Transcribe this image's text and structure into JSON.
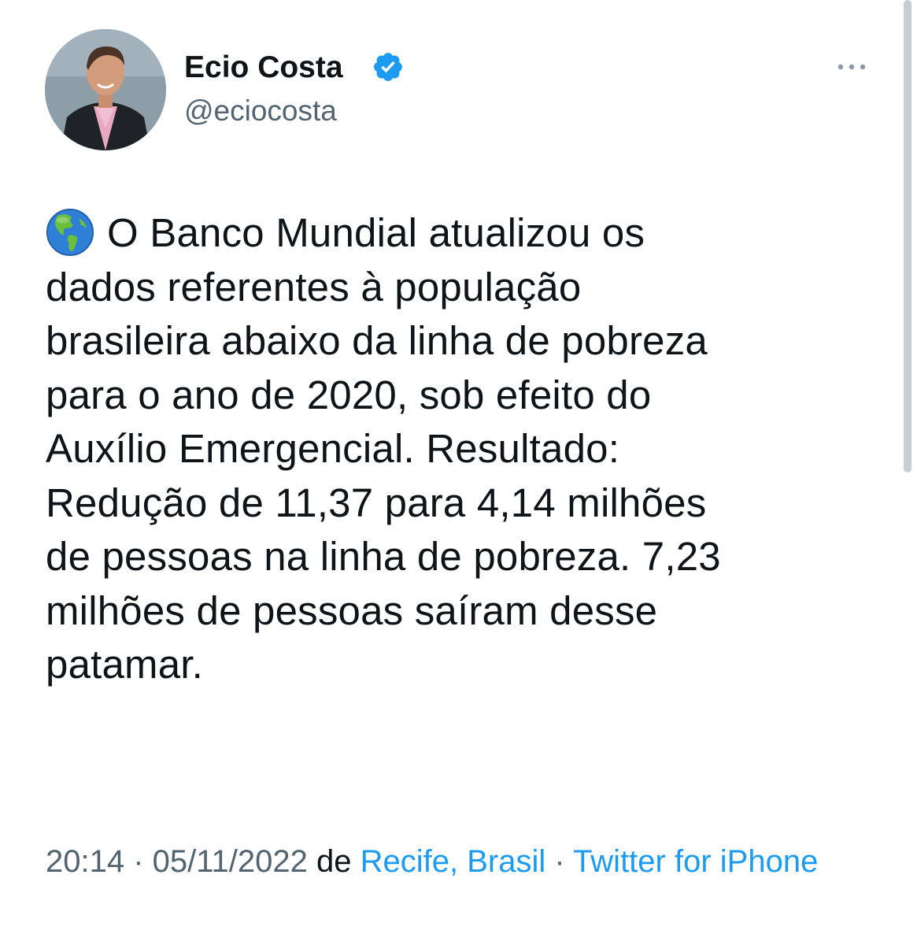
{
  "author": {
    "display_name": "Ecio Costa",
    "handle": "@eciocosta",
    "verified": true
  },
  "tweet": {
    "emoji": "globe-americas",
    "text": "O Banco Mundial atualizou os\ndados referentes à população\nbrasileira abaixo da linha de pobreza\npara o ano de 2020, sob efeito do\nAuxílio Emergencial. Resultado:\nRedução de 11,37 para 4,14 milhões\nde pessoas na linha de pobreza. 7,23\nmilhões de pessoas saíram desse\npatamar."
  },
  "meta": {
    "time": "20:14",
    "separator": " · ",
    "date": "05/11/2022",
    "location_prefix": " de ",
    "location": "Recife, Brasil",
    "separator2": " · ",
    "source": "Twitter for iPhone"
  },
  "colors": {
    "text": "#0f1419",
    "secondary": "#536471",
    "link": "#1d9bf0",
    "verified": "#1d9bf0"
  }
}
